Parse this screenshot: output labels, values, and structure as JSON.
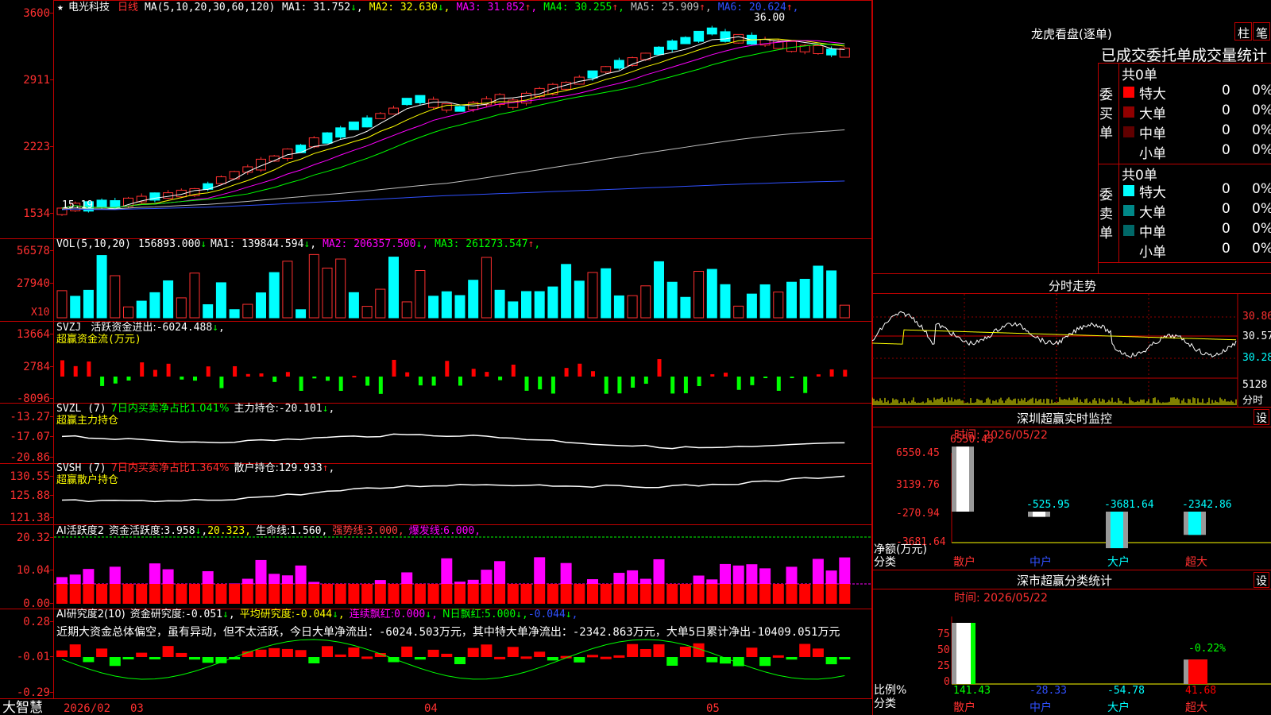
{
  "app": {
    "brand": "大智慧"
  },
  "stock": {
    "name": "电光科技",
    "period": "日线",
    "ma_params": "MA(5,10,20,30,60,120)",
    "mark_high": "36.00",
    "mark_low": "15.19",
    "ma": [
      {
        "label": "MA1:",
        "value": "31.752",
        "arrow": "↓",
        "color": "#ffffff"
      },
      {
        "label": "MA2:",
        "value": "32.630",
        "arrow": "↓",
        "color": "#ffff00"
      },
      {
        "label": "MA3:",
        "value": "31.852",
        "arrow": "↑",
        "color": "#ff00ff"
      },
      {
        "label": "MA4:",
        "value": "30.255",
        "arrow": "↑",
        "color": "#00ff00"
      },
      {
        "label": "MA5:",
        "value": "25.909",
        "arrow": "↑",
        "color": "#c0c0c0"
      },
      {
        "label": "MA6:",
        "value": "20.624",
        "arrow": "↑",
        "color": "#3050ff"
      }
    ],
    "price_axis": [
      "3600",
      "2911",
      "2223",
      "1534"
    ]
  },
  "vol": {
    "params": "VOL(5,10,20)",
    "value": "156893.000",
    "arrow": "↓",
    "ma": [
      {
        "label": "MA1:",
        "value": "139844.594",
        "arrow": "↓",
        "color": "#ffffff"
      },
      {
        "label": "MA2:",
        "value": "206357.500",
        "arrow": "↓",
        "color": "#ff00ff"
      },
      {
        "label": "MA3:",
        "value": "261273.547",
        "arrow": "↑",
        "color": "#00ff00"
      }
    ],
    "axis": [
      "56578",
      "27940"
    ],
    "unit": "X10"
  },
  "svzj": {
    "name": "SVZJ",
    "line1": "活跃资金进出:",
    "value": "-6024.488",
    "arrow": "↓",
    "subtitle": "超赢资金流(万元)",
    "axis": [
      "13664",
      "2784",
      "-8096"
    ]
  },
  "svzl": {
    "name": "SVZL (7)",
    "desc": "7日内买卖净占比1.041%",
    "label": "主力持仓:",
    "value": "-20.101",
    "arrow": "↓",
    "subtitle": "超赢主力持仓",
    "axis": [
      "-13.27",
      "-17.07",
      "-20.86"
    ]
  },
  "svsh": {
    "name": "SVSH (7)",
    "desc": "7日内买卖净占比1.364%",
    "label": "散户持仓:",
    "value": "129.933",
    "arrow": "↑",
    "subtitle": "超赢散户持仓",
    "axis": [
      "130.55",
      "125.88",
      "121.38"
    ]
  },
  "ai2": {
    "name": "AI活跃度2",
    "items": [
      {
        "label": "资金活跃度:",
        "value": "3.958",
        "arrow": "↓",
        "color": "#ffffff"
      },
      {
        "label": "",
        "value": "20.323",
        "arrow": "",
        "color": "#ffff00"
      },
      {
        "label": "生命线:",
        "value": "1.560",
        "arrow": "",
        "color": "#ffffff"
      },
      {
        "label": "强势线:",
        "value": "3.000",
        "arrow": "",
        "color": "#ff4040"
      },
      {
        "label": "爆发线:",
        "value": "6.000",
        "arrow": "",
        "color": "#ff00ff"
      }
    ],
    "axis": [
      "20.32",
      "10.04",
      "0.00"
    ]
  },
  "ai3": {
    "name": "AI研究度2(10)",
    "items": [
      {
        "label": "资金研究度:",
        "value": "-0.051",
        "arrow": "↓",
        "color": "#ffffff"
      },
      {
        "label": "平均研究度:",
        "value": "-0.044",
        "arrow": "↓",
        "color": "#ffff00"
      },
      {
        "label": "连续飘红:",
        "value": "0.000",
        "arrow": "↓",
        "color": "#ff00ff"
      },
      {
        "label": "N日飘红:",
        "value": "5.000",
        "arrow": "↓",
        "color": "#00ff00"
      },
      {
        "label": "",
        "value": "-0.044",
        "arrow": "↓",
        "color": "#3050ff"
      }
    ],
    "axis": [
      "0.28",
      "-0.01",
      "-0.29"
    ],
    "comment": "近期大资金总体偏空，虽有异动，但不太活跃，今日大单净流出：-6024.503万元，其中特大单净流出：-2342.863万元，大单5日累计净出-10409.051万元"
  },
  "dates": {
    "start": "2026/02",
    "m1": "03",
    "m2": "04",
    "m3": "05"
  },
  "dragon": {
    "title": "龙虎看盘(逐单)",
    "btn1": "柱",
    "btn2": "笔",
    "tab": "已成交委托单成交量统计",
    "buy": {
      "side": "委买单",
      "total": "共0单",
      "rows": [
        {
          "label": "特大",
          "val": "0",
          "pct": "0%",
          "color": "#ff0000"
        },
        {
          "label": "大单",
          "val": "0",
          "pct": "0%",
          "color": "#900000"
        },
        {
          "label": "中单",
          "val": "0",
          "pct": "0%",
          "color": "#600000"
        },
        {
          "label": "小单",
          "val": "0",
          "pct": "0%",
          "color": ""
        }
      ]
    },
    "sell": {
      "side": "委卖单",
      "total": "共0单",
      "rows": [
        {
          "label": "特大",
          "val": "0",
          "pct": "0%",
          "color": "#00ffff"
        },
        {
          "label": "大单",
          "val": "0",
          "pct": "0%",
          "color": "#008888"
        },
        {
          "label": "中单",
          "val": "0",
          "pct": "0%",
          "color": "#006868"
        },
        {
          "label": "小单",
          "val": "0",
          "pct": "0%",
          "color": ""
        }
      ]
    }
  },
  "intraday": {
    "title": "分时走势",
    "axis": [
      "30.86",
      "30.57",
      "30.28"
    ],
    "vol": "5128",
    "vol_unit": "分时"
  },
  "monitor": {
    "title": "深圳超赢实时监控",
    "btn": "设",
    "time": "时间: 2026/05/22",
    "axis": [
      "6550.45",
      "3139.76",
      "-270.94",
      "-3681.64"
    ],
    "ylabel": "净额(万元)",
    "xlabel": "分类",
    "bars": [
      {
        "cat": "散户",
        "label": "6550.45",
        "value": 6550.45,
        "color": "#ffffff"
      },
      {
        "cat": "中户",
        "label": "-525.95",
        "value": -525.95,
        "color": "#ffffff"
      },
      {
        "cat": "大户",
        "label": "-3681.64",
        "value": -3681.64,
        "color": "#00ffff"
      },
      {
        "cat": "超大",
        "label": "-2342.86",
        "value": -2342.86,
        "color": "#00ffff"
      }
    ]
  },
  "classify": {
    "title": "深市超赢分类统计",
    "btn": "设",
    "time": "时间: 2026/05/22",
    "axis": [
      "75",
      "50",
      "25",
      "0"
    ],
    "ylabel": "比例%",
    "xlabel": "分类",
    "pct_label": "-0.22%",
    "bars": [
      {
        "cat": "散户",
        "label": "141.43",
        "value": 100,
        "color": "#00ff00"
      },
      {
        "cat": "中户",
        "label": "-28.33",
        "value": 0,
        "color": "#3050ff"
      },
      {
        "cat": "大户",
        "label": "-54.78",
        "value": 0,
        "color": "#00ffff"
      },
      {
        "cat": "超大",
        "label": "41.68",
        "value": 40,
        "color": "#ff0000"
      }
    ]
  }
}
